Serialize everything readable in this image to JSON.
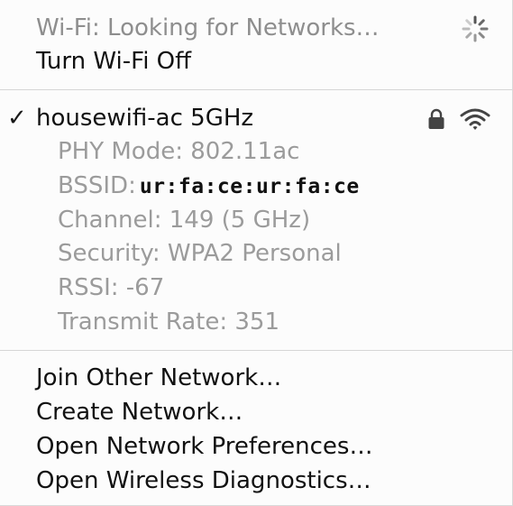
{
  "wifi_status": {
    "label": "Wi-Fi: Looking for Networks…",
    "spinner_icon": "loading-spinner-icon"
  },
  "toggle": {
    "label": "Turn Wi-Fi Off"
  },
  "network": {
    "checked": true,
    "check_glyph": "✓",
    "name": "housewifi-ac 5GHz",
    "secured_icon": "lock-icon",
    "signal_icon": "wifi-signal-icon",
    "details": {
      "phy_mode": "PHY Mode: 802.11ac",
      "bssid_label": "BSSID:",
      "bssid_value": "ur:fa:ce:ur:fa:ce",
      "channel": "Channel: 149 (5 GHz)",
      "security": "Security: WPA2 Personal",
      "rssi": "RSSI: -67",
      "transmit_rate": "Transmit Rate: 351"
    }
  },
  "actions": {
    "join_other": "Join Other Network…",
    "create": "Create Network…",
    "open_prefs": "Open Network Preferences…",
    "open_diagnostics": "Open Wireless Diagnostics…"
  }
}
